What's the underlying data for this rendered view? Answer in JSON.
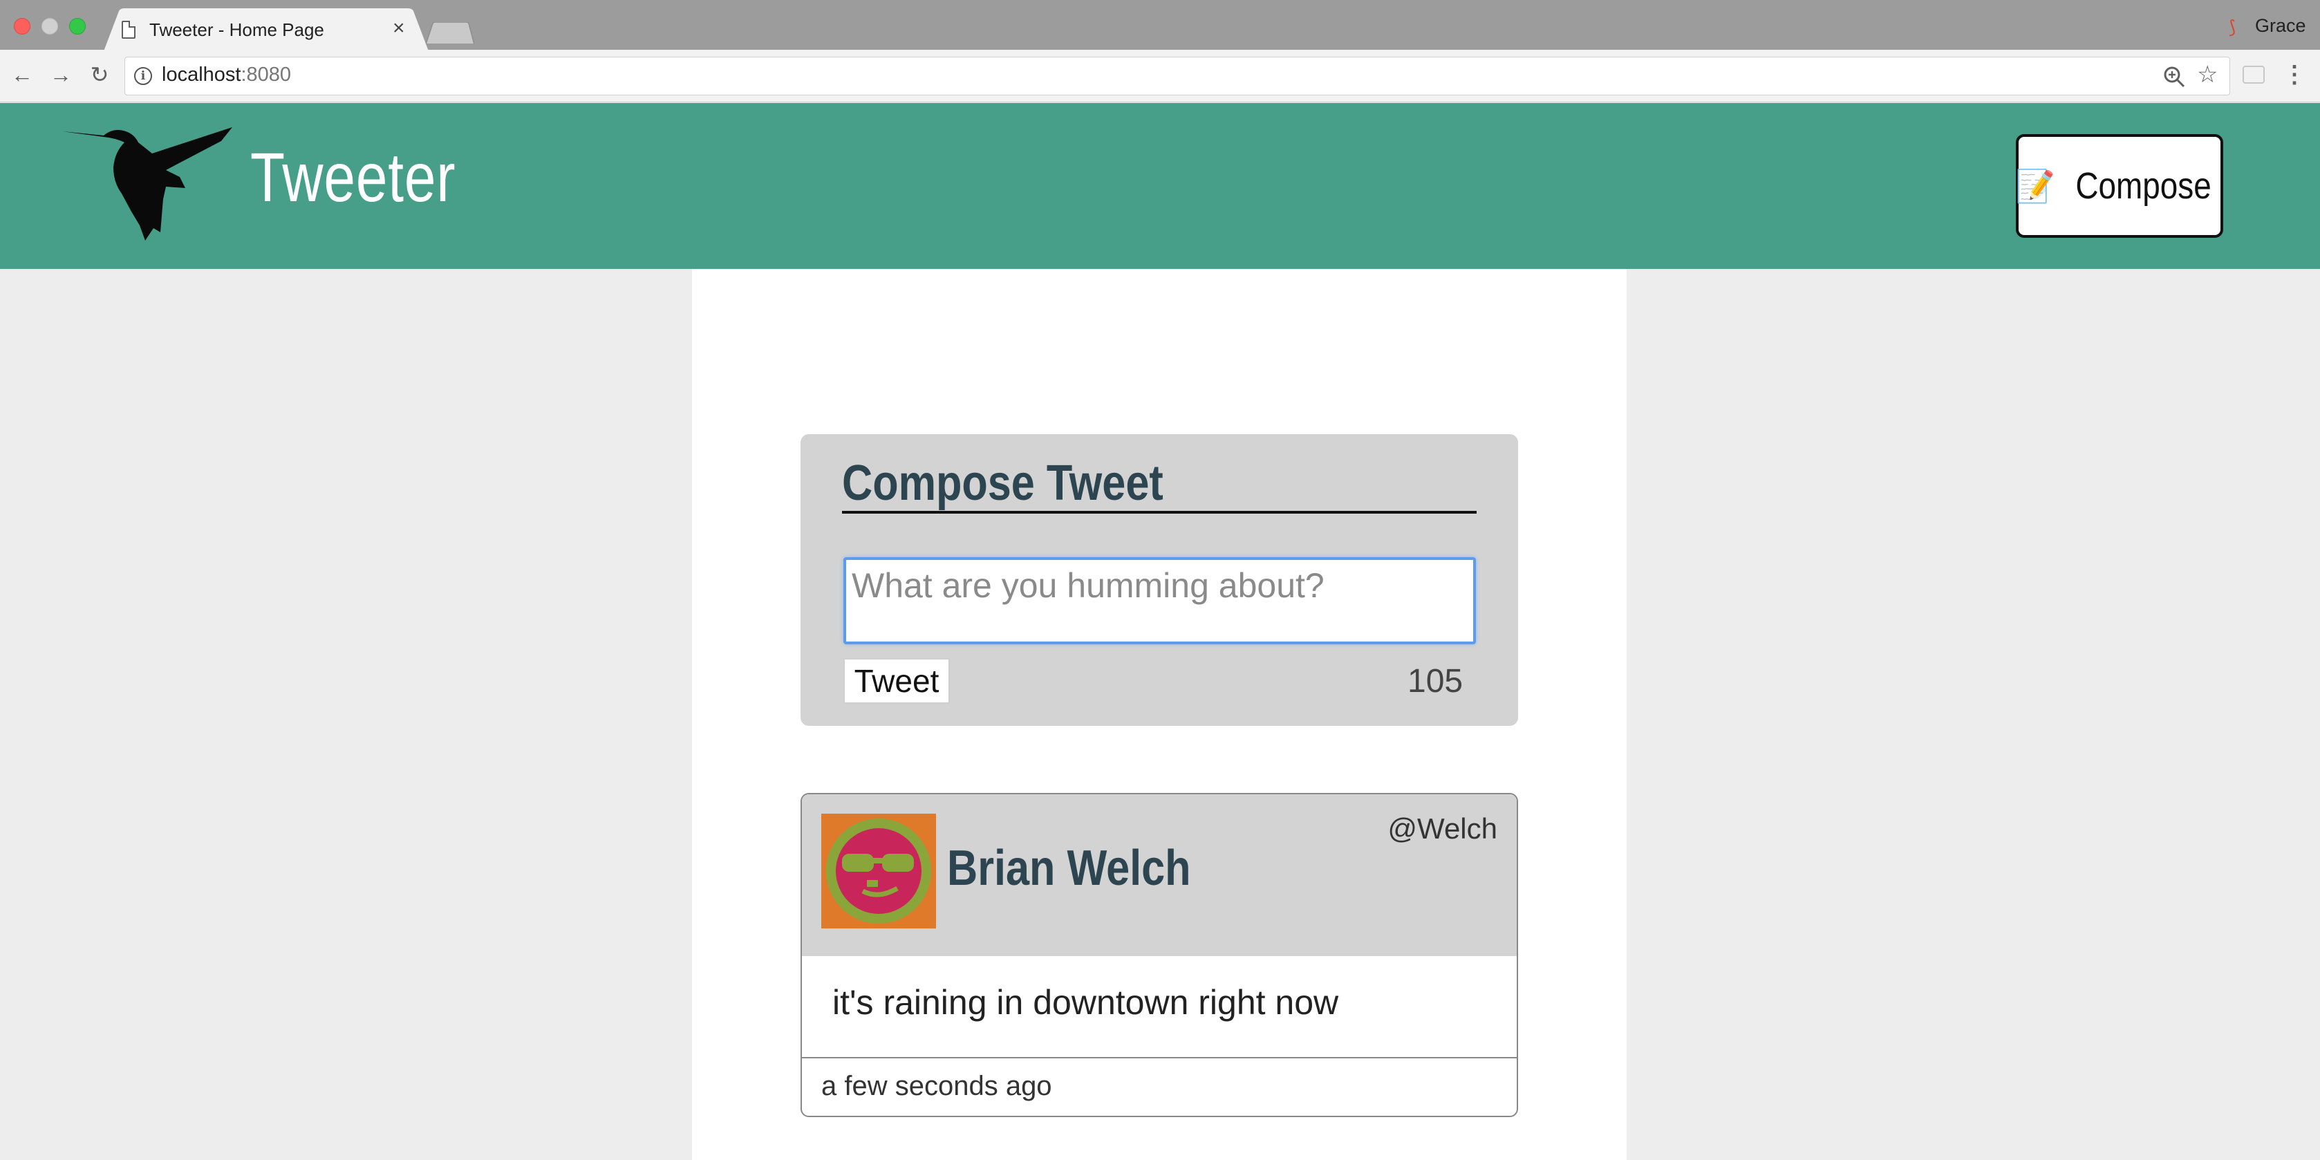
{
  "browser": {
    "tab_title": "Tweeter - Home Page",
    "tab_close": "×",
    "url_host": "localhost",
    "url_port": ":8080",
    "profile_name": "Grace"
  },
  "header": {
    "brand": "Tweeter",
    "compose_label": "Compose",
    "background_color": "#479f8a"
  },
  "compose": {
    "title": "Compose Tweet",
    "placeholder": "What are you humming about?",
    "submit_label": "Tweet",
    "counter": "105"
  },
  "tweets": [
    {
      "name": "Brian Welch",
      "handle": "@Welch",
      "text": "it's raining in downtown right now",
      "time": "a few seconds ago"
    }
  ]
}
